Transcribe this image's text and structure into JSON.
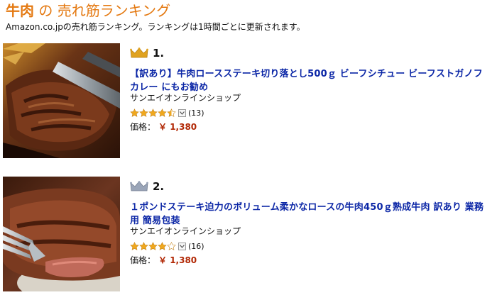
{
  "header": {
    "category": "牛肉",
    "title_rest": " の 売れ筋ランキング",
    "subtitle": "Amazon.co.jpの売れ筋ランキング。ランキングは1時間ごとに更新されます。"
  },
  "items": [
    {
      "rank": "1.",
      "crown_color": "#e0a21f",
      "title": "【訳あり】牛肉ロースステーキ切り落とし500ｇ ビーフシチュー ビーフストガノフ カレー にもお勧め",
      "seller": "サンエイオンラインショップ",
      "rating": 4.5,
      "review_count": "13",
      "price_label": "価格：",
      "price": "￥ 1,380"
    },
    {
      "rank": "2.",
      "crown_color": "#9aa5b8",
      "title": "１ポンドステーキ迫力のボリューム柔かなロースの牛肉450ｇ熟成牛肉 訳あり 業務用 簡易包装",
      "seller": "サンエイオンラインショップ",
      "rating": 4.0,
      "review_count": "16",
      "price_label": "価格：",
      "price": "￥ 1,380"
    }
  ],
  "colors": {
    "link": "#0b26a6",
    "price": "#b12704",
    "heading": "#e47911",
    "star": "#f0a81e"
  },
  "icons": {
    "rank_icon": "crown-icon",
    "rating_icon": "star-icon",
    "dropdown_icon": "chevron-down-icon"
  }
}
